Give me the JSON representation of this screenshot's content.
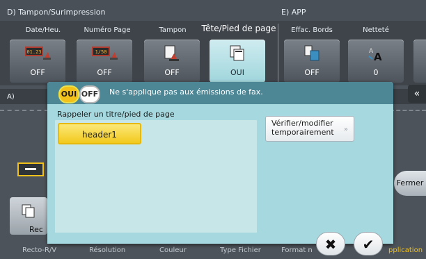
{
  "header": {
    "section_d": "D)  Tampon/Surimpression",
    "section_e": "E)  APP"
  },
  "tiles": [
    {
      "title": "Date/Heu.",
      "value": "OFF",
      "icon": "date-time-stamp-icon",
      "icon_text": "01.23"
    },
    {
      "title": "Numéro Page",
      "value": "OFF",
      "icon": "page-number-icon",
      "icon_text": "1/50"
    },
    {
      "title": "Tampon",
      "value": "OFF",
      "icon": "stamp-icon",
      "icon_text": ""
    },
    {
      "title": "Tête/Pied de page",
      "value": "OUI",
      "icon": "header-footer-icon",
      "icon_text": ""
    },
    {
      "title": "Effac. Bords",
      "value": "OFF",
      "icon": "frame-erase-icon",
      "icon_text": ""
    },
    {
      "title": "Netteté",
      "value": "0",
      "icon": "sharpness-icon",
      "icon_text": ""
    }
  ],
  "background": {
    "section_a": "A)",
    "close_label": "Fermer",
    "recto_tile": "Rec",
    "expand_icon": "double-chevron-left-icon"
  },
  "modal": {
    "on_label": "OUI",
    "off_label": "OFF",
    "notice": "Ne s'applique pas aux émissions de fax.",
    "list_label": "Rappeler un titre/pied de page",
    "items": [
      "header1"
    ],
    "verify_label_1": "Vérifier/modifier",
    "verify_label_2": "temporairement",
    "cancel_icon": "close-x-icon",
    "ok_icon": "check-icon"
  },
  "bottom_bar": {
    "items": [
      "Recto-R/V",
      "Résolution",
      "Couleur",
      "Type Fichier",
      "Format n",
      "pplication"
    ]
  },
  "colors": {
    "accent_yellow": "#f3c21a",
    "modal_teal": "#a5d9df",
    "title_teal": "#4d8796",
    "active_tile": "#cfecf0"
  }
}
